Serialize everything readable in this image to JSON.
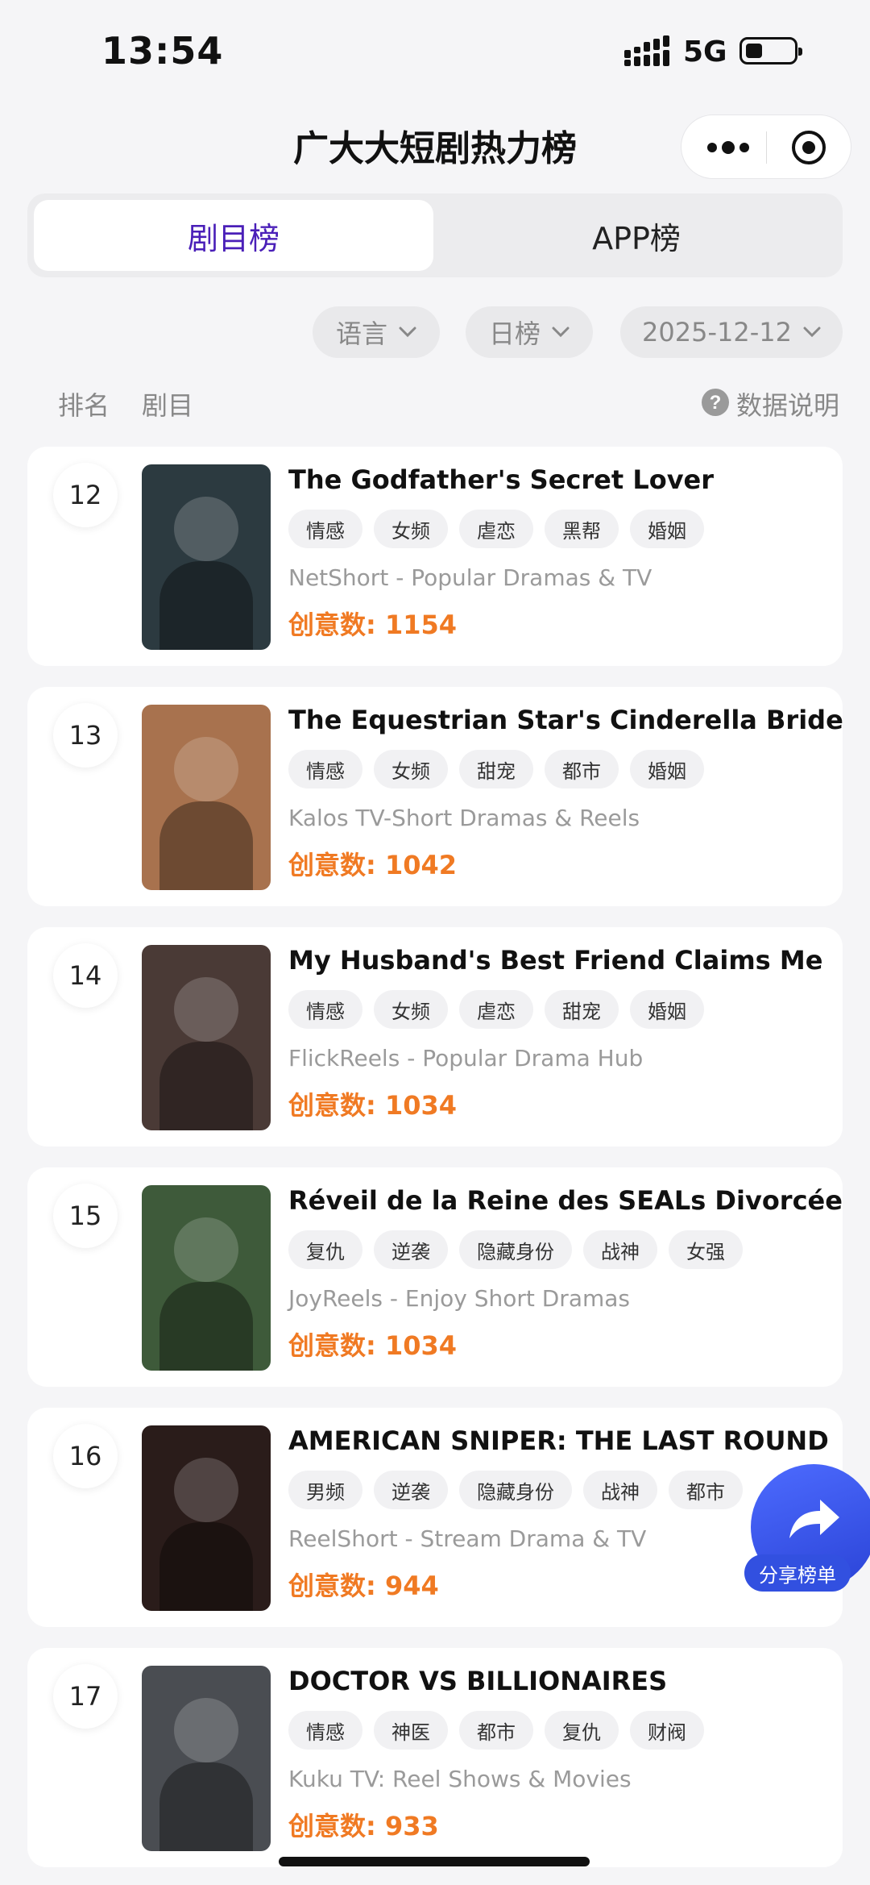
{
  "status_bar": {
    "time": "13:54",
    "network": "5G"
  },
  "header": {
    "title": "广大大短剧热力榜"
  },
  "tabs": [
    {
      "label": "剧目榜",
      "active": true
    },
    {
      "label": "APP榜",
      "active": false
    }
  ],
  "filters": {
    "language": "语言",
    "period": "日榜",
    "date": "2025-12-12"
  },
  "list_header": {
    "rank": "排名",
    "title": "剧目",
    "help": "数据说明"
  },
  "share": {
    "label": "分享榜单"
  },
  "metric_label": "创意数: ",
  "items": [
    {
      "rank": "12",
      "title": "The Godfather's Secret Lover",
      "tags": [
        "情感",
        "女频",
        "虐恋",
        "黑帮",
        "婚姻"
      ],
      "app": "NetShort - Popular Dramas & TV",
      "metric": "创意数: 1154",
      "poster_color": "#2c3a40"
    },
    {
      "rank": "13",
      "title": "The Equestrian Star's Cinderella Bride",
      "tags": [
        "情感",
        "女频",
        "甜宠",
        "都市",
        "婚姻"
      ],
      "app": "Kalos TV-Short Dramas & Reels",
      "metric": "创意数: 1042",
      "poster_color": "#a8724e"
    },
    {
      "rank": "14",
      "title": "My Husband's Best Friend Claims Me",
      "tags": [
        "情感",
        "女频",
        "虐恋",
        "甜宠",
        "婚姻"
      ],
      "app": "FlickReels - Popular Drama Hub",
      "metric": "创意数: 1034",
      "poster_color": "#4a3a36"
    },
    {
      "rank": "15",
      "title": "Réveil de la Reine des SEALs Divorcée",
      "tags": [
        "复仇",
        "逆袭",
        "隐藏身份",
        "战神",
        "女强"
      ],
      "app": "JoyReels - Enjoy Short Dramas",
      "metric": "创意数: 1034",
      "poster_color": "#3e5a3a"
    },
    {
      "rank": "16",
      "title": "AMERICAN SNIPER: THE LAST ROUND",
      "tags": [
        "男频",
        "逆袭",
        "隐藏身份",
        "战神",
        "都市"
      ],
      "app": "ReelShort - Stream Drama & TV",
      "metric": "创意数: 944",
      "poster_color": "#2a1c1a"
    },
    {
      "rank": "17",
      "title": "DOCTOR VS BILLIONAIRES",
      "tags": [
        "情感",
        "神医",
        "都市",
        "复仇",
        "财阀"
      ],
      "app": "Kuku TV: Reel Shows & Movies",
      "metric": "创意数: 933",
      "poster_color": "#4a4d52"
    }
  ],
  "colors": {
    "accent": "#4a1fb8",
    "metric": "#f07a23",
    "share": "#3250e0"
  }
}
